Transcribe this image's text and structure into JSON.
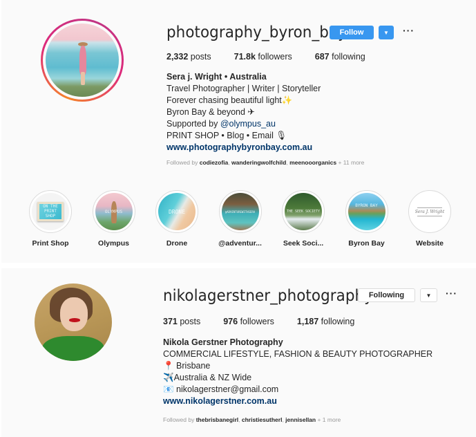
{
  "profiles": [
    {
      "username": "photography_byron_bay",
      "story_ring": true,
      "primary_button": "Follow",
      "dropdown_icon": "caret-down-icon",
      "more_icon": "more-options-icon",
      "more_label": "···",
      "stats": {
        "posts_value": "2,332",
        "posts_label": "posts",
        "followers_value": "71.8k",
        "followers_label": "followers",
        "following_value": "687",
        "following_label": "following"
      },
      "bio": {
        "name": "Sera j. Wright • Australia",
        "line1": "Travel Photographer | Writer | Storyteller",
        "line2": "Forever chasing beautiful light✨",
        "line3": "Byron Bay & beyond ✈",
        "line4_prefix": "Supported by ",
        "line4_mention": "@olympus_au",
        "line5": "PRINT SHOP • Blog • Email 🎙",
        "website": "www.photographybyronbay.com.au"
      },
      "followed_by": {
        "prefix": "Followed by ",
        "users": [
          "codiezofia",
          "wanderingwolfchild",
          "meenooorganics"
        ],
        "more": " + 11 more"
      },
      "highlights": [
        {
          "label": "Print Shop",
          "overlay": "ON THE PRINT SHOP"
        },
        {
          "label": "Olympus",
          "overlay": "OLYMPUS"
        },
        {
          "label": "Drone",
          "overlay": "DRONE"
        },
        {
          "label": "@adventur...",
          "overlay": "@ADVENTUREWITHSERA"
        },
        {
          "label": "Seek Soci...",
          "overlay": "THE SEEK SOCIETY"
        },
        {
          "label": "Byron Bay",
          "overlay": "BYRON BAY"
        },
        {
          "label": "Website",
          "overlay": "Sera J. Wright"
        }
      ]
    },
    {
      "username": "nikolagerstner_photography",
      "story_ring": false,
      "primary_button": "Following",
      "dropdown_icon": "caret-down-icon",
      "more_icon": "more-options-icon",
      "more_label": "···",
      "stats": {
        "posts_value": "371",
        "posts_label": "posts",
        "followers_value": "976",
        "followers_label": "followers",
        "following_value": "1,187",
        "following_label": "following"
      },
      "bio": {
        "name": "Nikola Gerstner Photography",
        "line1": "COMMERCIAL LIFESTYLE, FASHION & BEAUTY PHOTOGRAPHER",
        "line2": "📍 Brisbane",
        "line3": "✈️Australia & NZ Wide",
        "line4": "📧 nikolagerstner@gmail.com",
        "website": "www.nikolagerstner.com.au"
      },
      "followed_by": {
        "prefix": "Followed by ",
        "users": [
          "thebrisbanegirl",
          "christiesutherl",
          "jennisellan"
        ],
        "more": " + 1 more"
      }
    }
  ],
  "colors": {
    "accent_blue": "#3897f0",
    "link_navy": "#003569",
    "panel_bg": "#fafafa",
    "text": "#262626",
    "muted": "#999999"
  }
}
